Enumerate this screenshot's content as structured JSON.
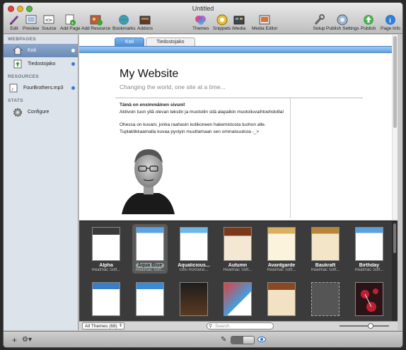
{
  "window": {
    "title": "Untitled"
  },
  "toolbar": {
    "left": [
      {
        "label": "Edit",
        "icon": "pencil-icon"
      },
      {
        "label": "Preview",
        "icon": "preview-icon"
      },
      {
        "label": "Source",
        "icon": "source-code-icon"
      },
      {
        "label": "Add Page",
        "icon": "add-page-icon"
      },
      {
        "label": "Add Resource",
        "icon": "add-resource-icon"
      },
      {
        "label": "Bookmarks",
        "icon": "globe-icon"
      },
      {
        "label": "Addons",
        "icon": "addons-box-icon"
      }
    ],
    "middle": [
      {
        "label": "Themes",
        "icon": "themes-icon"
      },
      {
        "label": "Snippets",
        "icon": "snippets-icon"
      },
      {
        "label": "iMedia",
        "icon": "imedia-icon"
      },
      {
        "label": "Media Editor",
        "icon": "media-editor-icon"
      }
    ],
    "right": [
      {
        "label": "Setup",
        "icon": "wrench-icon"
      },
      {
        "label": "Publish Settings",
        "icon": "publish-settings-icon"
      },
      {
        "label": "Publish",
        "icon": "publish-icon"
      },
      {
        "label": "Page Info",
        "icon": "info-icon"
      }
    ]
  },
  "sidebar": {
    "webpages_header": "WEBPAGES",
    "pages": [
      {
        "label": "Koti",
        "selected": true
      },
      {
        "label": "Tiedostojako",
        "selected": false
      }
    ],
    "resources_header": "RESOURCES",
    "resources": [
      {
        "label": "FourBrothers.mp3"
      }
    ],
    "stats_header": "STATS",
    "stats": [
      {
        "label": "Configure"
      }
    ]
  },
  "page": {
    "tabs": [
      {
        "label": "Koti",
        "active": true
      },
      {
        "label": "Tiedostojako",
        "active": false
      }
    ],
    "site_title": "My Website",
    "site_tagline": "Changing the world, one site at a time...",
    "heading": "Tämä on ensimmäinen sivuni!",
    "para1": "Aktivoin tuon yllä olevan tekstin ja muotoilin sitä alapalkin muotoiluvaihtoehdoilla!",
    "para2": "Ohessa on kuvani, jonka raahasin kotikoneen hakemistosta tuohon alle. Tuplaklikkaamalla kuvaa pystyin muuttamaan sen ominaisuuksia -_>"
  },
  "themes": {
    "row1": [
      {
        "name": "Alpha",
        "author": "Realmac Soft..."
      },
      {
        "name": "Aqua Blue",
        "author": "Realmac Soft...",
        "selected": true
      },
      {
        "name": "Aqualicious...",
        "author": "Otto Romano..."
      },
      {
        "name": "Autumn",
        "author": "Realmac Soft..."
      },
      {
        "name": "Avantgarde",
        "author": "Realmac Soft..."
      },
      {
        "name": "Baukraft",
        "author": "Realmac Soft..."
      },
      {
        "name": "Birthday",
        "author": "Realmac Soft..."
      }
    ],
    "filter": "All Themes (68)",
    "search_placeholder": "Search"
  }
}
